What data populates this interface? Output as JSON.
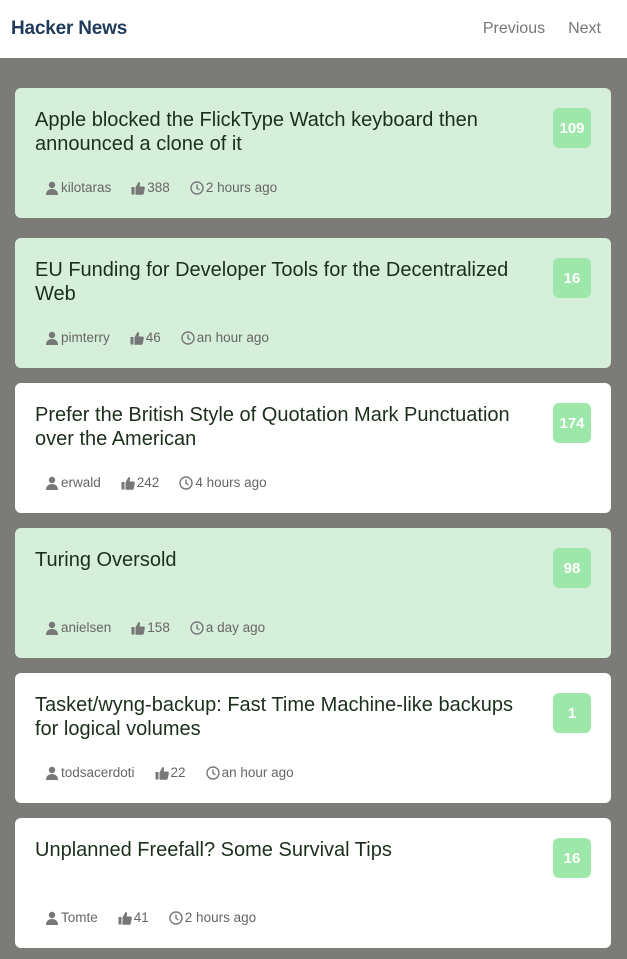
{
  "header": {
    "brand": "Hacker News",
    "prev_label": "Previous",
    "next_label": "Next"
  },
  "stories": [
    {
      "title": "Apple blocked the FlickType Watch keyboard then announced a clone of it",
      "comments": "109",
      "author": "kilotaras",
      "points": "388",
      "time": "2 hours ago",
      "bg": "green"
    },
    {
      "title": "EU Funding for Developer Tools for the Decentralized Web",
      "comments": "16",
      "author": "pimterry",
      "points": "46",
      "time": "an hour ago",
      "bg": "green"
    },
    {
      "title": "Prefer the British Style of Quotation Mark Punctuation over the American",
      "comments": "174",
      "author": "erwald",
      "points": "242",
      "time": "4 hours ago",
      "bg": "white"
    },
    {
      "title": "Turing Oversold",
      "comments": "98",
      "author": "anielsen",
      "points": "158",
      "time": "a day ago",
      "bg": "green"
    },
    {
      "title": "Tasket/wyng-backup: Fast Time Machine-like backups for logical volumes",
      "comments": "1",
      "author": "todsacerdoti",
      "points": "22",
      "time": "an hour ago",
      "bg": "white"
    },
    {
      "title": "Unplanned Freefall? Some Survival Tips",
      "comments": "16",
      "author": "Tomte",
      "points": "41",
      "time": "2 hours ago",
      "bg": "white"
    }
  ],
  "icons": {
    "author": "user-icon",
    "points": "thumbs-up-icon",
    "time": "clock-icon"
  },
  "colors": {
    "highlight_bg": "#d6efda",
    "badge": "#9de7ab",
    "brand": "#1f3a5a",
    "backdrop": "#7b7b78"
  }
}
